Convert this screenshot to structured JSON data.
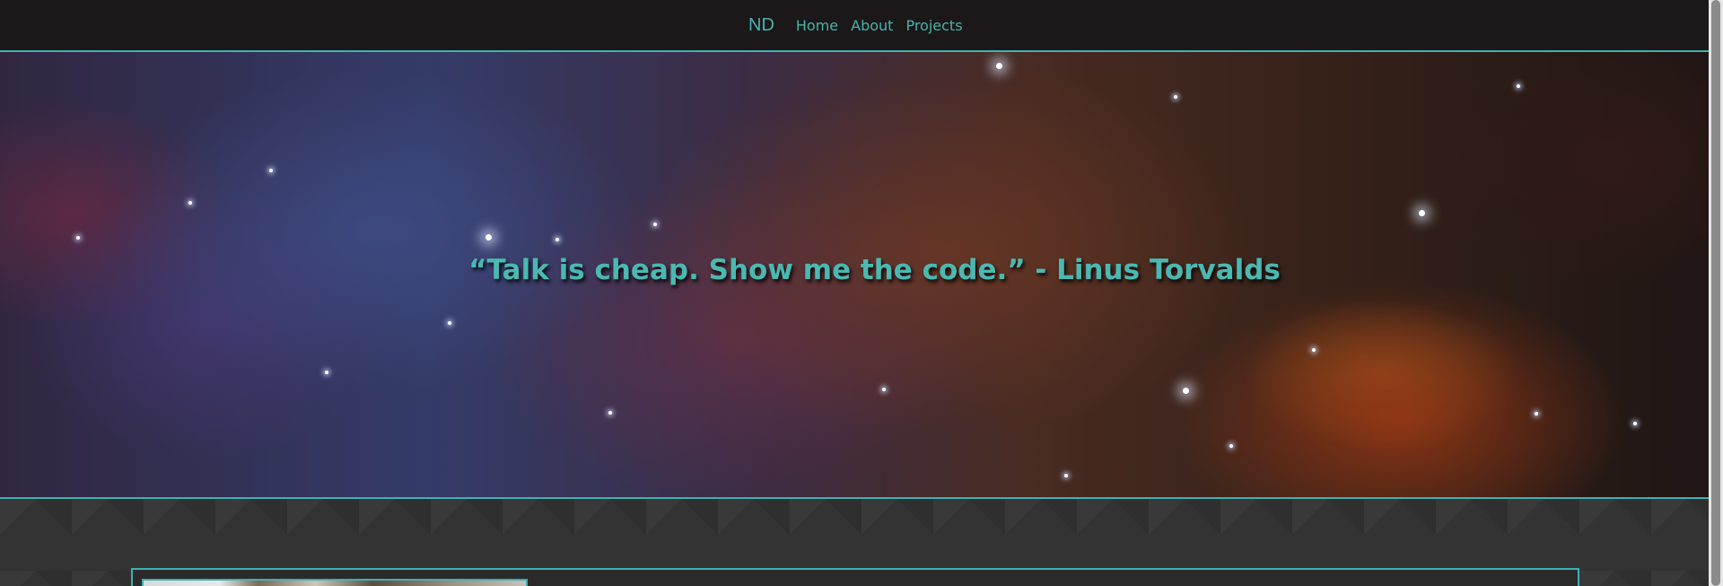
{
  "nav": {
    "brand": "ND",
    "links": [
      "Home",
      "About",
      "Projects"
    ]
  },
  "hero": {
    "quote": "“Talk is cheap. Show me the code.” - Linus Torvalds"
  },
  "colors": {
    "accent": "#3fb1b1",
    "nav_bg": "#1c1718",
    "content_bg": "#333333"
  }
}
